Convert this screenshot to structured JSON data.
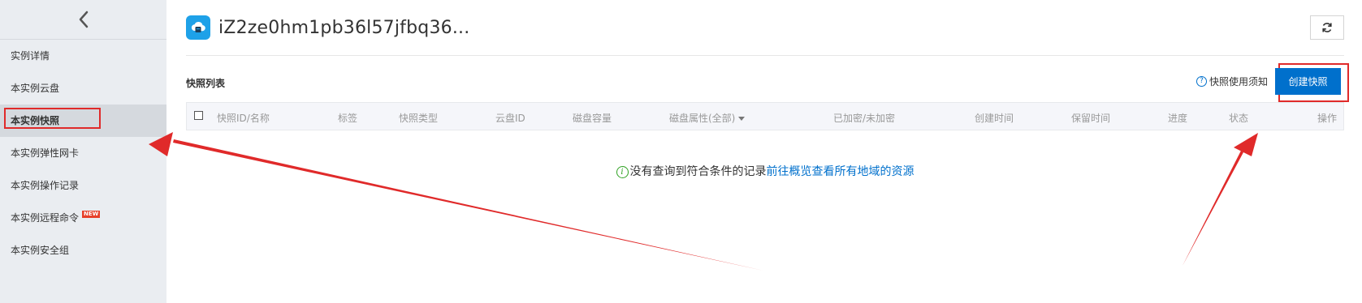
{
  "sidebar": {
    "collapse_icon": "chevron-left-icon",
    "items": [
      {
        "label": "实例详情"
      },
      {
        "label": "本实例云盘"
      },
      {
        "label": "本实例快照",
        "active": true
      },
      {
        "label": "本实例弹性网卡"
      },
      {
        "label": "本实例操作记录"
      },
      {
        "label": "本实例远程命令",
        "badge": "NEW"
      },
      {
        "label": "本实例安全组"
      }
    ]
  },
  "header": {
    "instance_icon": "cloud-server-icon",
    "title": "iZ2ze0hm1pb36l57jfbq36...",
    "refresh_icon": "refresh-icon"
  },
  "snapshots": {
    "section_title": "快照列表",
    "help_icon": "question-circle-icon",
    "help_label": "快照使用须知",
    "create_label": "创建快照",
    "columns": {
      "name": "快照ID/名称",
      "tags": "标签",
      "type": "快照类型",
      "disk_id": "云盘ID",
      "capacity": "磁盘容量",
      "attribute": "磁盘属性(全部)",
      "encryption": "已加密/未加密",
      "created": "创建时间",
      "retention": "保留时间",
      "progress": "进度",
      "status": "状态",
      "actions": "操作"
    },
    "empty": {
      "icon": "info-circle-icon",
      "message": "没有查询到符合条件的记录",
      "link": "前往概览查看所有地域的资源"
    }
  },
  "colors": {
    "primary": "#0070cc",
    "annotation": "#e02a2a",
    "sidebar_bg": "#eaedf1",
    "instance_icon": "#1ea1e8",
    "badge": "#e7402a"
  }
}
